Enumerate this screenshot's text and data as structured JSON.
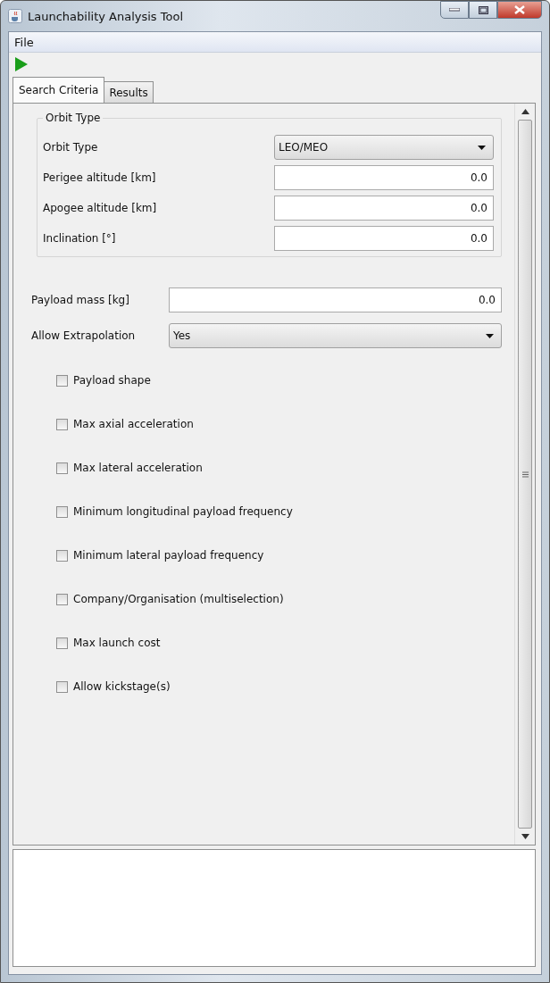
{
  "window": {
    "title": "Launchability Analysis Tool"
  },
  "menu": [
    "File"
  ],
  "tabs": [
    {
      "label": "Search Criteria",
      "selected": true
    },
    {
      "label": "Results",
      "selected": false
    }
  ],
  "orbit_group": {
    "title": "Orbit Type",
    "fields": [
      {
        "kind": "dropdown",
        "label": "Orbit Type",
        "value": "LEO/MEO"
      },
      {
        "kind": "text",
        "label": "Perigee altitude [km]",
        "value": "0.0"
      },
      {
        "kind": "text",
        "label": "Apogee altitude [km]",
        "value": "0.0"
      },
      {
        "kind": "text",
        "label": "Inclination [°]",
        "value": "0.0"
      }
    ]
  },
  "fields": [
    {
      "kind": "text",
      "label": "Payload mass [kg]",
      "value": "0.0"
    },
    {
      "kind": "dropdown",
      "label": "Allow Extrapolation",
      "value": "Yes"
    }
  ],
  "options": [
    {
      "label": "Payload shape",
      "checked": false
    },
    {
      "label": "Max axial acceleration",
      "checked": false
    },
    {
      "label": "Max lateral acceleration",
      "checked": false
    },
    {
      "label": "Minimum longitudinal payload frequency",
      "checked": false
    },
    {
      "label": "Minimum lateral payload frequency",
      "checked": false
    },
    {
      "label": "Company/Organisation (multiselection)",
      "checked": false
    },
    {
      "label": "Max launch cost",
      "checked": false
    },
    {
      "label": "Allow kickstage(s)",
      "checked": false
    }
  ]
}
